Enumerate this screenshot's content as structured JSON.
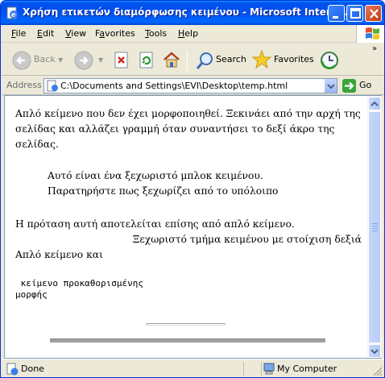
{
  "window": {
    "title": "Χρήση ετικετών διαμόρφωσης κειμένου - Microsoft Interne..."
  },
  "menu": [
    {
      "label": "File",
      "key": "F",
      "rest": "ile"
    },
    {
      "label": "Edit",
      "key": "E",
      "rest": "dit"
    },
    {
      "label": "View",
      "key": "V",
      "rest": "iew"
    },
    {
      "label": "Favorites",
      "key": "a",
      "pre": "F",
      "rest": "vorites"
    },
    {
      "label": "Tools",
      "key": "T",
      "rest": "ools"
    },
    {
      "label": "Help",
      "key": "H",
      "rest": "elp"
    }
  ],
  "toolbar": {
    "back_label": "Back",
    "search_label": "Search",
    "favorites_label": "Favorites"
  },
  "address": {
    "label": "Address",
    "value": "C:\\Documents and Settings\\EVI\\Desktop\\temp.html",
    "go_label": "Go"
  },
  "document": {
    "paragraph1": "Απλό κείμενο που δεν έχει μορφοποιηθεί. Ξεκινάει από την αρχή της σελίδας και αλλάζει γραμμή όταν συναντήσει το δεξί άκρο της σελίδας.",
    "blockquote_line1": "Αυτό είναι ένα ξεχωριστό μπλοκ κειμένου.",
    "blockquote_line2": "Παρατηρήστε πως ξεχωρίζει από το υπόλοιπο",
    "paragraph2": "Η πρόταση αυτή αποτελείται επίσης από απλό κείμενο.",
    "right_aligned": "Ξεχωριστό τμήμα κειμένου με στοίχιση δεξιά",
    "paragraph3": "Απλό κείμενο και",
    "preformatted": " κείμενο προκαθορισμένης\nμορφής"
  },
  "status": {
    "text": "Done",
    "zone": "My Computer"
  },
  "colors": {
    "title_bar": "#0054e3",
    "window_face": "#ece9d8",
    "close_button": "#c03a14"
  }
}
